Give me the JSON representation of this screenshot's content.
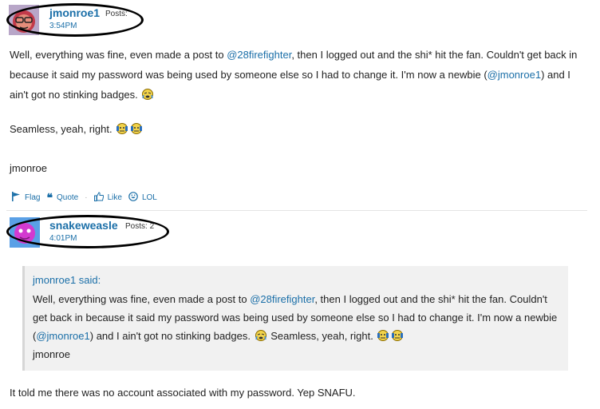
{
  "post1": {
    "username": "jmonroe1",
    "posts_label": "Posts:",
    "time": "3:54PM",
    "text_a": "Well, everything was fine, even made a post to ",
    "mention_a": "@28firefighter",
    "text_b": ", then I logged out and the shi* hit the fan. Couldn't get back in because it said my password was being used by someone else so I had to change it. I'm now a newbie (",
    "mention_b": "@jmonroe1",
    "text_c": ") and I ain't got no stinking badges.",
    "text_d": "Seamless, yeah, right.",
    "signature": "jmonroe"
  },
  "actions": {
    "flag": "Flag",
    "quote": "Quote",
    "like": "Like",
    "lol": "LOL"
  },
  "post2": {
    "username": "snakeweasle",
    "posts_label": "Posts: 2",
    "time": "4:01PM",
    "quote_author": "jmonroe1 said:",
    "quote_a": "Well, everything was fine, even made a post to ",
    "quote_mention_a": "@28firefighter",
    "quote_b": ", then I logged out and the shi* hit the fan. Couldn't get back in because it said my password was being used by someone else so I had to change it. I'm now a newbie (",
    "quote_mention_b": "@jmonroe1",
    "quote_c": ") and I ain't got no stinking badges.",
    "quote_d": " Seamless, yeah, right.",
    "quote_sig": "jmonroe",
    "reply": "It told me there was no account associated with my password. Yep SNAFU."
  },
  "icons": [
    "flag-icon",
    "quote-icon",
    "like-icon",
    "lol-icon",
    "crying-emoji",
    "annoyed-emoji"
  ],
  "colors": {
    "link": "#1b6fa8",
    "quote_bg": "#f1f1f1",
    "ring": "#000000"
  }
}
